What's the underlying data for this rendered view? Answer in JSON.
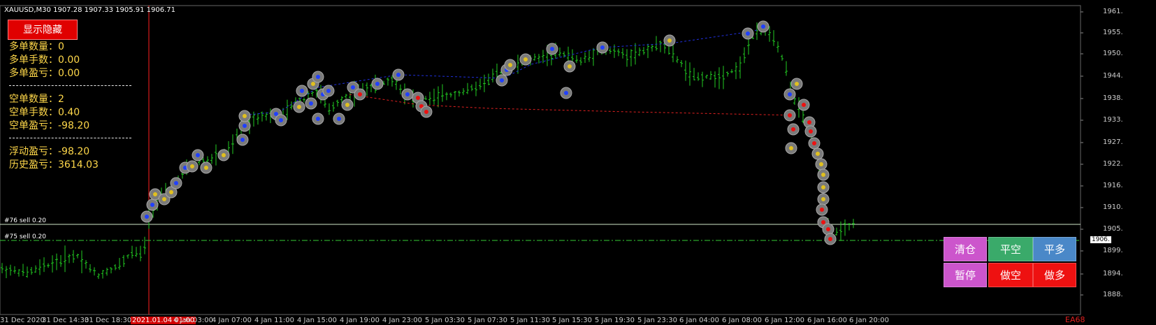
{
  "header": {
    "symbol_info": "XAUUSD,M30  1907.28 1907.33 1905.91 1906.71"
  },
  "panel": {
    "toggle_button": "显示隐藏",
    "long_count": "多单数量：0",
    "long_lots": "多单手数：0.00",
    "long_pl": "多单盈亏：0.00",
    "short_count": "空单数量：2",
    "short_lots": "空单手数：0.40",
    "short_pl": "空单盈亏：-98.20",
    "float_pl": "浮动盈亏：-98.20",
    "history_pl": "历史盈亏：3614.03"
  },
  "orders": {
    "order76": "#76 sell 0.20",
    "order75": "#75 sell 0.20"
  },
  "trade_buttons": {
    "close_all": "清仓",
    "close_short": "平空",
    "close_long": "平多",
    "pause": "暂停",
    "open_short": "做空",
    "open_long": "做多"
  },
  "colors": {
    "close_all": "#cc55cc",
    "close_short": "#3aaa6a",
    "close_long": "#4a88c8",
    "pause": "#cc55cc",
    "open_short": "#ee1111",
    "open_long": "#ee1111",
    "candle": "#22cc22",
    "price_line": "#cfe8c8"
  },
  "price_axis": {
    "ticks": [
      "1961.",
      "1955.",
      "1950.",
      "1944.",
      "1938.",
      "1933.",
      "1927.",
      "1922.",
      "1916.",
      "1910.",
      "1905.",
      "1899.",
      "1894.",
      "1888."
    ],
    "current_price_tag": "1906."
  },
  "time_axis": {
    "highlighted": "2021.01.04 01:00",
    "ticks": [
      "31 Dec 2020",
      "31 Dec 14:30",
      "31 Dec 18:30",
      "4 Jan 03:00",
      "4 Jan 07:00",
      "4 Jan 11:00",
      "4 Jan 15:00",
      "4 Jan 19:00",
      "4 Jan 23:00",
      "5 Jan 03:30",
      "5 Jan 07:30",
      "5 Jan 11:30",
      "5 Jan 15:30",
      "5 Jan 19:30",
      "5 Jan 23:30",
      "6 Jan 04:00",
      "6 Jan 08:00",
      "6 Jan 12:00",
      "6 Jan 16:00",
      "6 Jan 20:00"
    ]
  },
  "logo_text": "EA68"
}
